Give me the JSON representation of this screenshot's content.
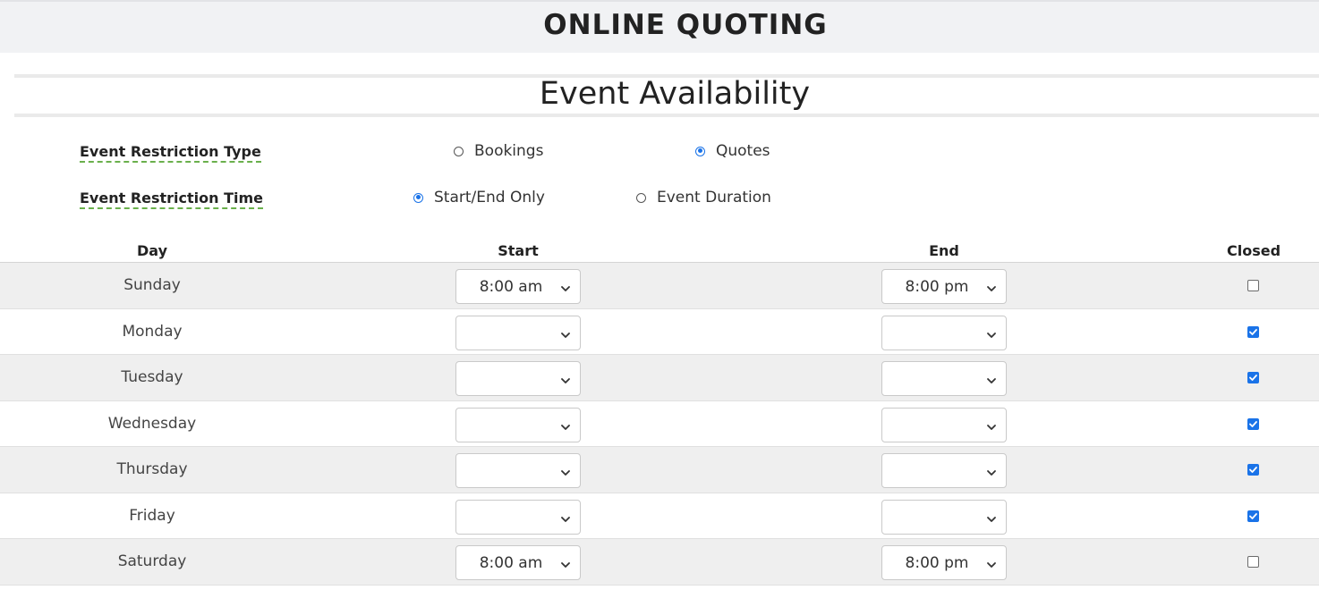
{
  "header": {
    "title": "ONLINE QUOTING"
  },
  "section": {
    "title": "Event Availability"
  },
  "restriction_type": {
    "label": "Event Restriction Type",
    "options": [
      {
        "label": "Bookings",
        "selected": false
      },
      {
        "label": "Quotes",
        "selected": true
      }
    ]
  },
  "restriction_time": {
    "label": "Event Restriction Time",
    "options": [
      {
        "label": "Start/End Only",
        "selected": true
      },
      {
        "label": "Event Duration",
        "selected": false
      }
    ]
  },
  "table": {
    "headers": {
      "day": "Day",
      "start": "Start",
      "end": "End",
      "closed": "Closed"
    },
    "rows": [
      {
        "day": "Sunday",
        "start": "8:00 am",
        "end": "8:00 pm",
        "closed": false
      },
      {
        "day": "Monday",
        "start": "",
        "end": "",
        "closed": true
      },
      {
        "day": "Tuesday",
        "start": "",
        "end": "",
        "closed": true
      },
      {
        "day": "Wednesday",
        "start": "",
        "end": "",
        "closed": true
      },
      {
        "day": "Thursday",
        "start": "",
        "end": "",
        "closed": true
      },
      {
        "day": "Friday",
        "start": "",
        "end": "",
        "closed": true
      },
      {
        "day": "Saturday",
        "start": "8:00 am",
        "end": "8:00 pm",
        "closed": false
      }
    ]
  },
  "colors": {
    "accent": "#1a73e8",
    "row_shade": "#efefef",
    "header_bg": "#f1f2f4",
    "underline": "#6ab04c"
  }
}
